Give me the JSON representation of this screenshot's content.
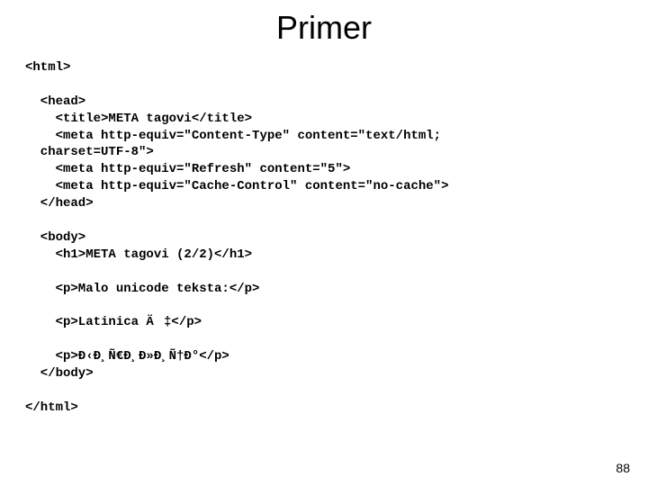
{
  "title": "Primer",
  "page_number": "88",
  "code": {
    "l01": "<html>",
    "l02": "  <head>",
    "l03": "    <title>META tagovi</title>",
    "l04": "    <meta http-equiv=\"Content-Type\" content=\"text/html;",
    "l05": "  charset=UTF-8\">",
    "l06": "    <meta http-equiv=\"Refresh\" content=\"5\">",
    "l07": "    <meta http-equiv=\"Cache-Control\" content=\"no-cache\">",
    "l08": "  </head>",
    "l09": "  <body>",
    "l10": "    <h1>META tagovi (2/2)</h1>",
    "l11": "    <p>Malo unicode teksta:</p>",
    "l12": "    <p>Latinica Ä‡</p>",
    "l13": "    <p>Đ‹Đ¸Ñ€Đ¸Đ»Đ¸Ñ†Đ°</p>",
    "l14": "  </body>",
    "l15": "</html>"
  }
}
